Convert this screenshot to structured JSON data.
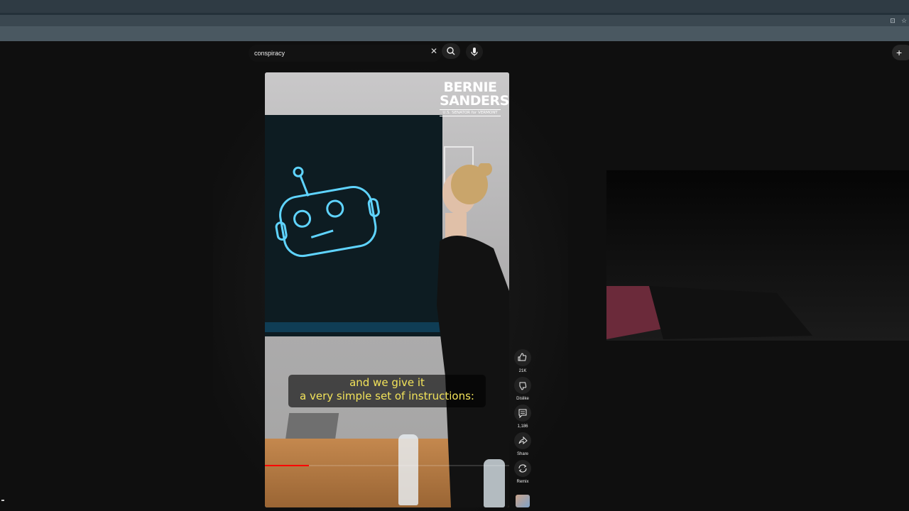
{
  "search": {
    "query": "conspiracy"
  },
  "video": {
    "logo_top": "BERNIE",
    "logo_bottom": "SANDERS",
    "logo_sub": "U.S. SENATOR for VERMONT",
    "caption_line1": "and we give it",
    "caption_line2": "a very simple set of instructions:",
    "progress": 0.18
  },
  "actions": {
    "like_count": "21K",
    "dislike_label": "Dislike",
    "comment_count": "1,186",
    "share_label": "Share",
    "remix_label": "Remix"
  },
  "colors": {
    "caption": "#f2e35a",
    "progress": "#ff0000",
    "neon": "#5fd4ff"
  }
}
